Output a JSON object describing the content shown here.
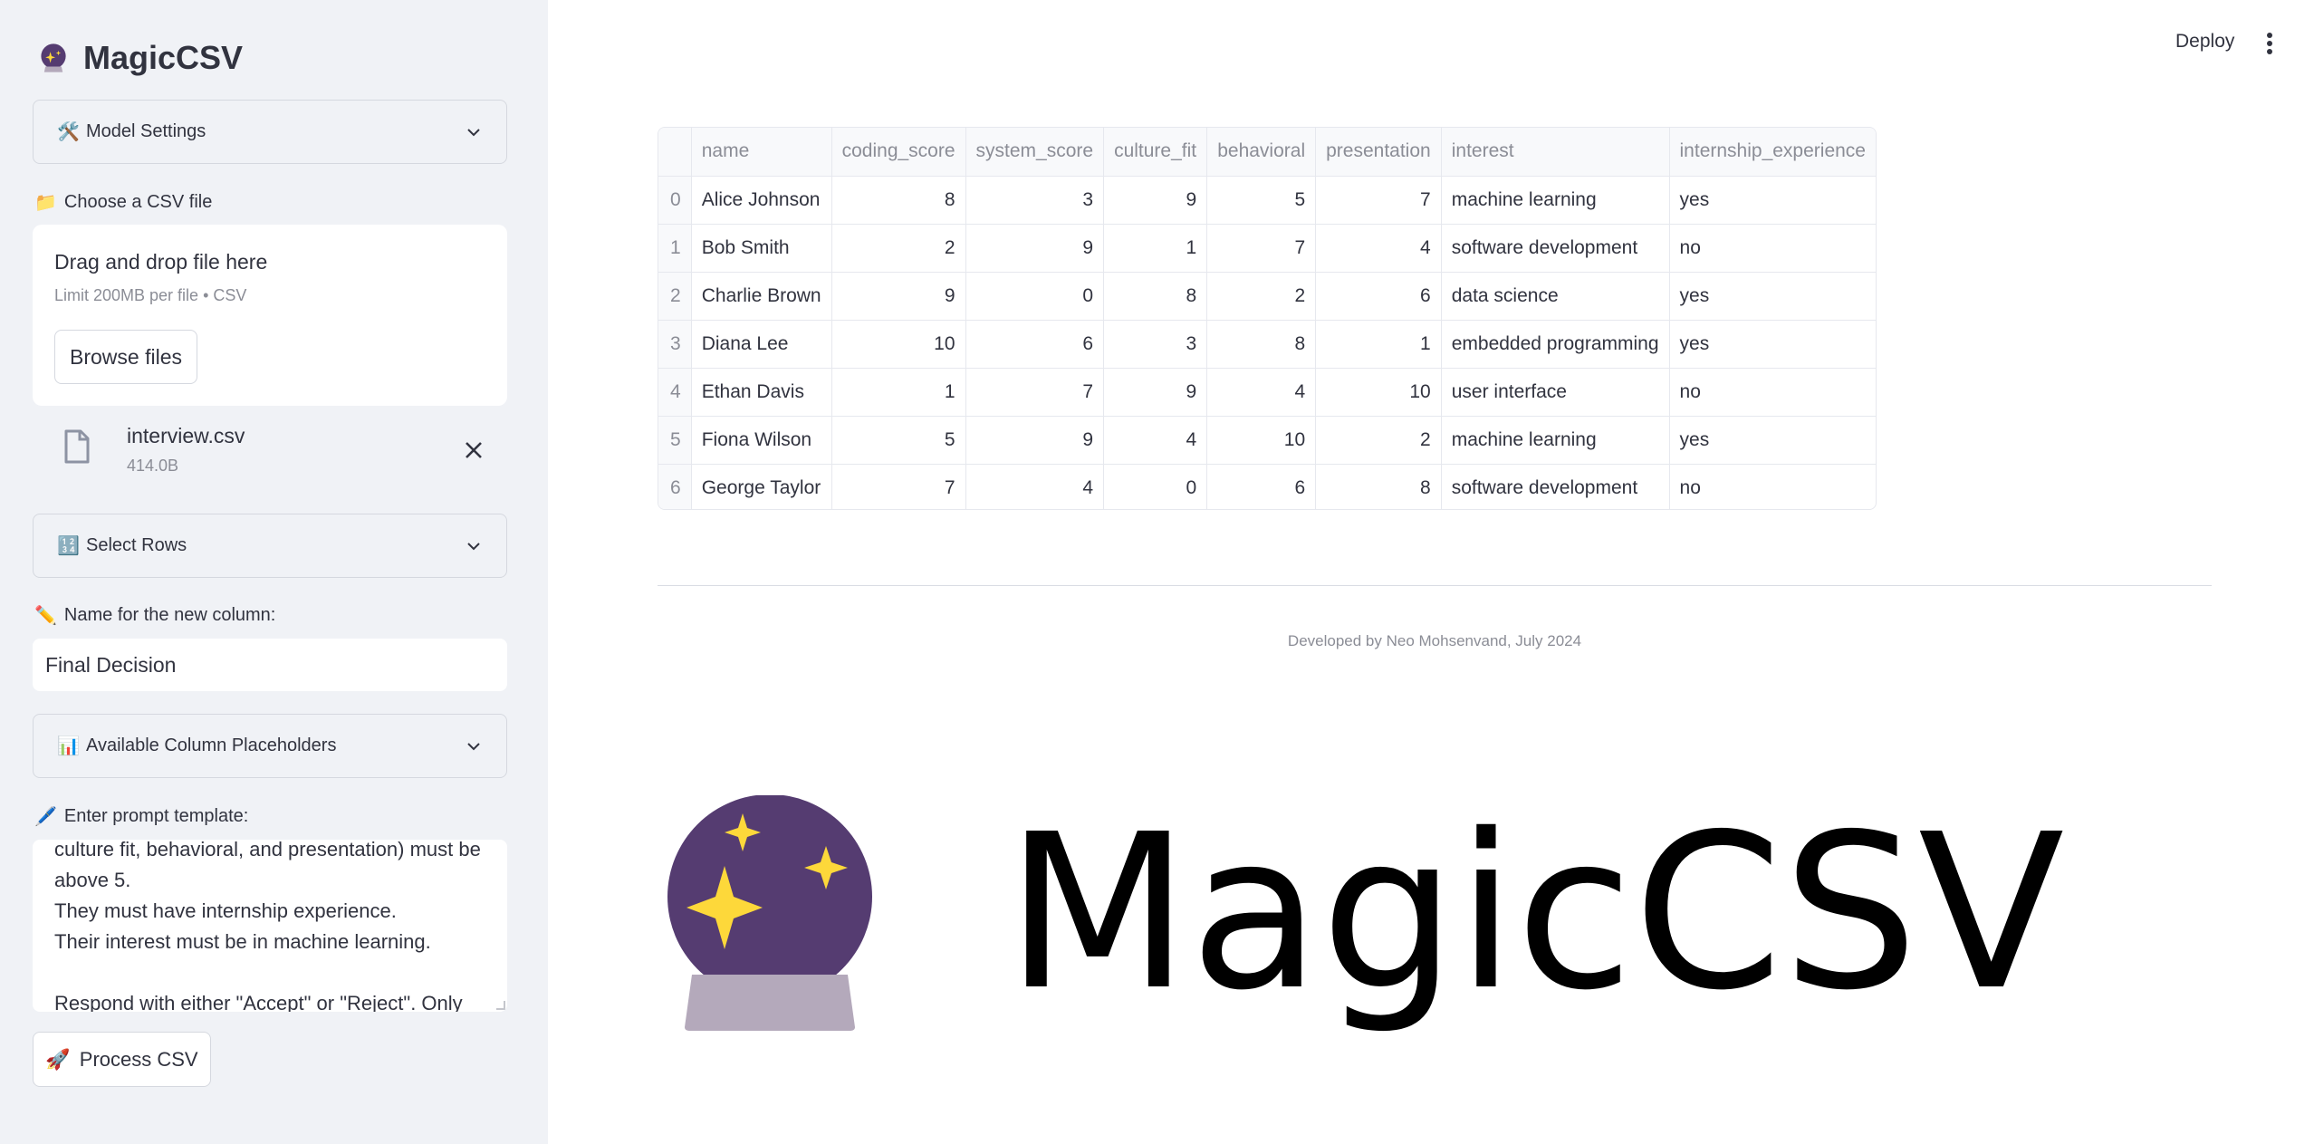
{
  "sidebar": {
    "app_title": "MagicCSV",
    "model_settings": {
      "icon": "🛠️",
      "label": "Model Settings"
    },
    "file_uploader": {
      "icon": "📁",
      "label": "Choose a CSV file",
      "drop_text": "Drag and drop file here",
      "limit_text": "Limit 200MB per file • CSV",
      "browse_label": "Browse files"
    },
    "uploaded_file": {
      "name": "interview.csv",
      "size": "414.0B"
    },
    "select_rows": {
      "icon": "🔢",
      "label": "Select Rows"
    },
    "new_column": {
      "icon": "✏️",
      "label": "Name for the new column:",
      "value": "Final Decision"
    },
    "placeholders": {
      "icon": "📊",
      "label": "Available Column Placeholders"
    },
    "prompt": {
      "icon": "🖊️",
      "label": "Enter prompt template:",
      "text": "culture fit, behavioral, and presentation) must be above 5.\nThey must have internship experience.\nTheir interest must be in machine learning.\n\nRespond with either \"Accept\" or \"Reject\". Only"
    },
    "process_button": {
      "icon": "🚀",
      "label": "Process CSV"
    }
  },
  "header": {
    "deploy_label": "Deploy",
    "menu_icon": "kebab-menu-icon"
  },
  "table": {
    "columns": [
      "",
      "name",
      "coding_score",
      "system_score",
      "culture_fit",
      "behavioral",
      "presentation",
      "interest",
      "internship_experience"
    ],
    "rows": [
      [
        "0",
        "Alice Johnson",
        "8",
        "3",
        "9",
        "5",
        "7",
        "machine learning",
        "yes"
      ],
      [
        "1",
        "Bob Smith",
        "2",
        "9",
        "1",
        "7",
        "4",
        "software development",
        "no"
      ],
      [
        "2",
        "Charlie Brown",
        "9",
        "0",
        "8",
        "2",
        "6",
        "data science",
        "yes"
      ],
      [
        "3",
        "Diana Lee",
        "10",
        "6",
        "3",
        "8",
        "1",
        "embedded programming",
        "yes"
      ],
      [
        "4",
        "Ethan Davis",
        "1",
        "7",
        "9",
        "4",
        "10",
        "user interface",
        "no"
      ],
      [
        "5",
        "Fiona Wilson",
        "5",
        "9",
        "4",
        "10",
        "2",
        "machine learning",
        "yes"
      ],
      [
        "6",
        "George Taylor",
        "7",
        "4",
        "0",
        "6",
        "8",
        "software development",
        "no"
      ]
    ]
  },
  "footer": {
    "credit": "Developed by Neo Mohsenvand, July 2024"
  },
  "logo": {
    "icon": "crystal-ball-icon",
    "text": "MagicCSV"
  },
  "colors": {
    "sidebar_bg": "#f0f2f6",
    "ball_purple": "#553c71",
    "ball_base": "#b4a9bb",
    "star_yellow": "#fdd83a"
  }
}
